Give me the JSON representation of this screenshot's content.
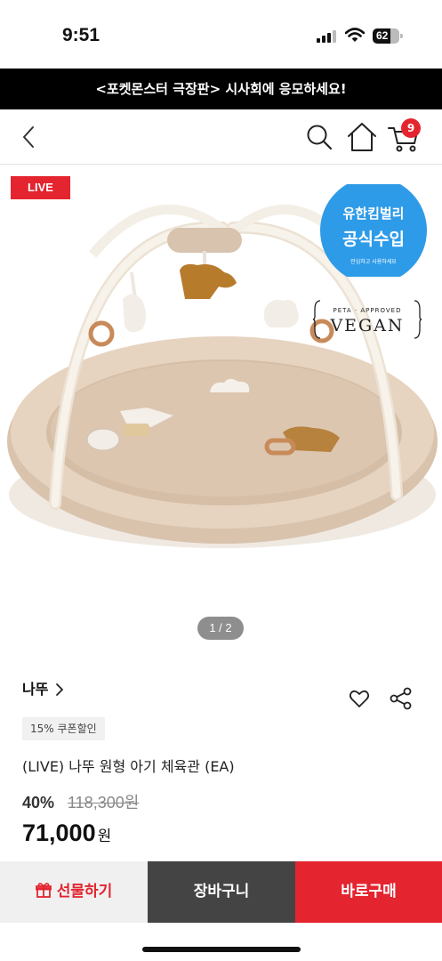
{
  "status_bar": {
    "time": "9:51",
    "battery": "62"
  },
  "promo_banner": {
    "text": "<포켓몬스터 극장판> 시사회에 응모하세요!"
  },
  "nav": {
    "cart_count": "9"
  },
  "product_image": {
    "live_label": "LIVE",
    "official_badge": {
      "line1": "유한킴벌리",
      "line2": "공식수입",
      "line3": "안심하고 사용하세요"
    },
    "vegan_badge": {
      "small": "PETA · APPROVED",
      "big": "VEGAN"
    }
  },
  "pager": {
    "text": "1 / 2"
  },
  "product": {
    "brand": "나뚜",
    "coupon": "15% 쿠폰할인",
    "title": "(LIVE) 나뚜 원형 아기 체육관 (EA)",
    "discount_rate": "40%",
    "original_price": "118,300원",
    "sale_price": "71,000",
    "currency": "원"
  },
  "bottom_bar": {
    "gift": "선물하기",
    "cart": "장바구니",
    "buy": "바로구매"
  },
  "colors": {
    "accent": "#e4242f",
    "dark_button": "#444444",
    "banner": "#000000",
    "official_blue": "#2e9be8"
  }
}
